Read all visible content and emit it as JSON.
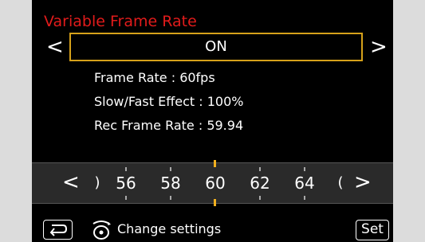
{
  "screen": {
    "title": "Variable Frame Rate",
    "value": "ON",
    "prev_arrow": "<",
    "next_arrow": ">",
    "info": {
      "frame_rate": "Frame Rate : 60fps",
      "slow_fast_effect": "Slow/Fast Effect : 100%",
      "rec_frame_rate": "Rec Frame Rate : 59.94"
    },
    "dial": {
      "left_arrow": "<",
      "right_arrow": ">",
      "partial_left": ")",
      "partial_right": "(",
      "values": [
        "56",
        "58",
        "60",
        "62",
        "64"
      ],
      "selected": "60"
    },
    "footer": {
      "back_icon": "return-icon",
      "dial_icon": "dial-icon",
      "change_label": "Change settings",
      "set_label": "Set"
    }
  },
  "colors": {
    "title": "#e11b1b",
    "highlight": "#d6a11a",
    "marker": "#f2b01e",
    "background": "#000000"
  }
}
